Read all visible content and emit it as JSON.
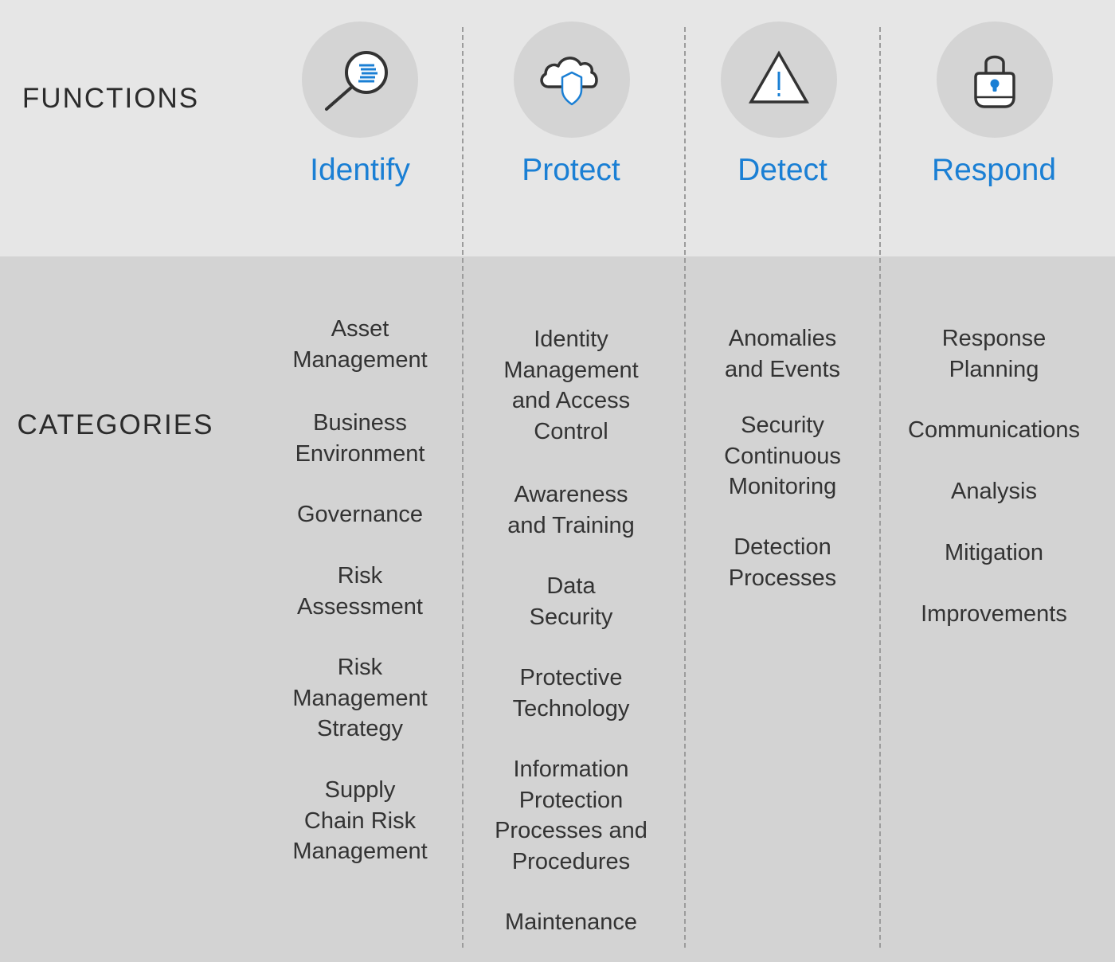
{
  "labels": {
    "functions": "FUNCTIONS",
    "categories": "CATEGORIES"
  },
  "colors": {
    "accent_blue": "#1a7fd4",
    "top_band": "#e6e6e6",
    "bottom_band": "#d3d3d3",
    "icon_circle": "#d4d4d4",
    "text": "#333333",
    "divider": "#9c9c9c"
  },
  "functions": [
    {
      "name": "Identify",
      "icon": "magnifier-document-icon",
      "categories": [
        "Asset\nManagement",
        "Business\nEnvironment",
        "Governance",
        "Risk\nAssessment",
        "Risk\nManagement\nStrategy",
        "Supply\nChain Risk\nManagement"
      ]
    },
    {
      "name": "Protect",
      "icon": "cloud-shield-icon",
      "categories": [
        "Identity\nManagement\nand Access\nControl",
        "Awareness\nand Training",
        "Data\nSecurity",
        "Protective\nTechnology",
        "Information\nProtection\nProcesses and\nProcedures",
        "Maintenance"
      ]
    },
    {
      "name": "Detect",
      "icon": "warning-triangle-icon",
      "categories": [
        "Anomalies\nand Events",
        "Security\nContinuous\nMonitoring",
        "Detection\nProcesses"
      ]
    },
    {
      "name": "Respond",
      "icon": "padlock-icon",
      "categories": [
        "Response\nPlanning",
        "Communications",
        "Analysis",
        "Mitigation",
        "Improvements"
      ]
    }
  ]
}
